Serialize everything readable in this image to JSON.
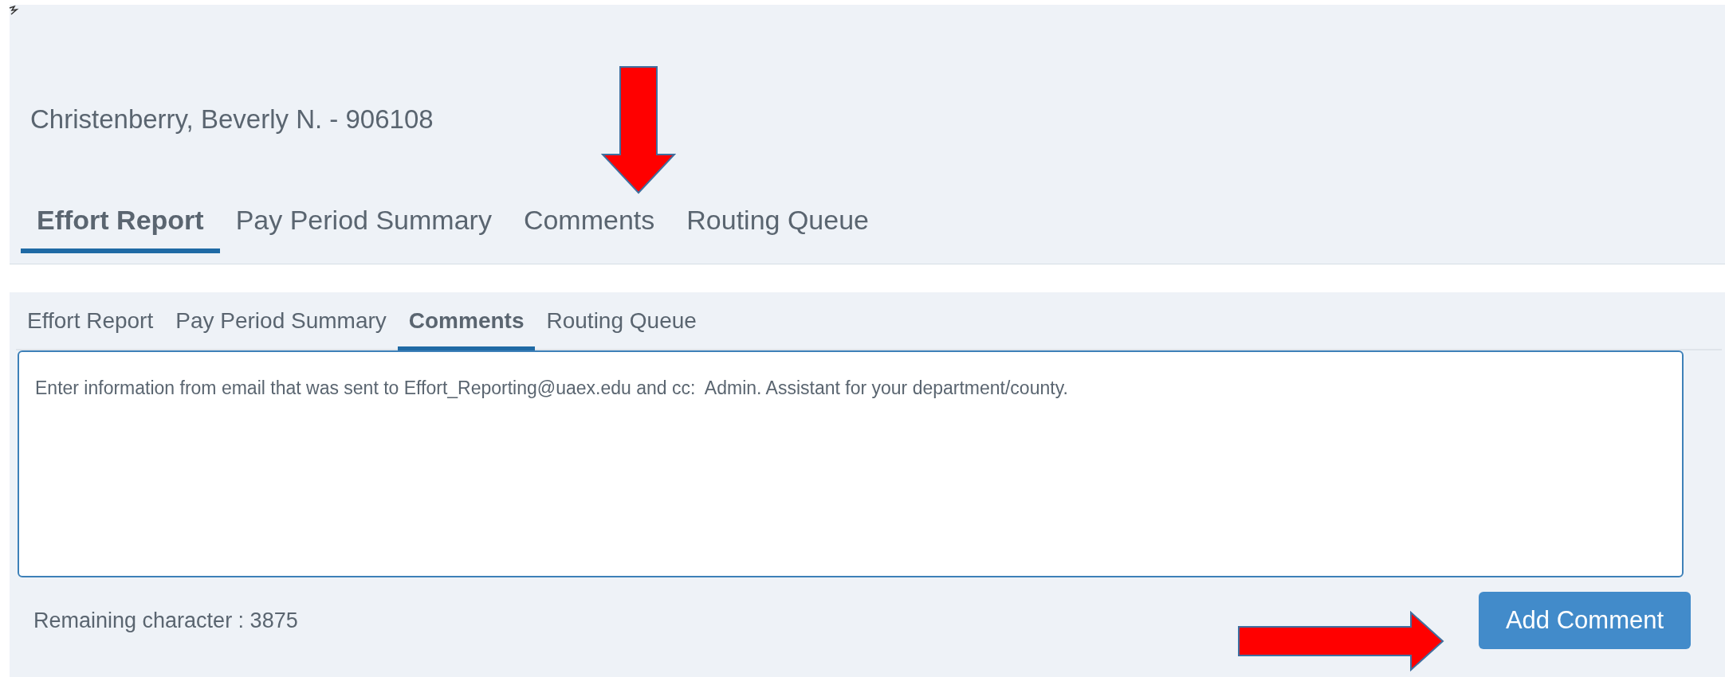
{
  "header": {
    "title": "Christenberry, Beverly N. - 906108"
  },
  "tabs": [
    {
      "label": "Effort Report",
      "selected": true
    },
    {
      "label": "Pay Period Summary",
      "selected": false
    },
    {
      "label": "Comments",
      "selected": false
    },
    {
      "label": "Routing Queue",
      "selected": false
    }
  ],
  "comments_panel": {
    "tabs": [
      {
        "label": "Effort Report",
        "selected": false
      },
      {
        "label": "Pay Period Summary",
        "selected": false
      },
      {
        "label": "Comments",
        "selected": true
      },
      {
        "label": "Routing Queue",
        "selected": false
      }
    ],
    "comment_field": {
      "placeholder": "Enter information from email that was sent to Effort_Reporting@uaex.edu and cc:  Admin. Assistant for your department/county."
    },
    "remaining": "Remaining character : 3875",
    "button": "Add Comment"
  }
}
